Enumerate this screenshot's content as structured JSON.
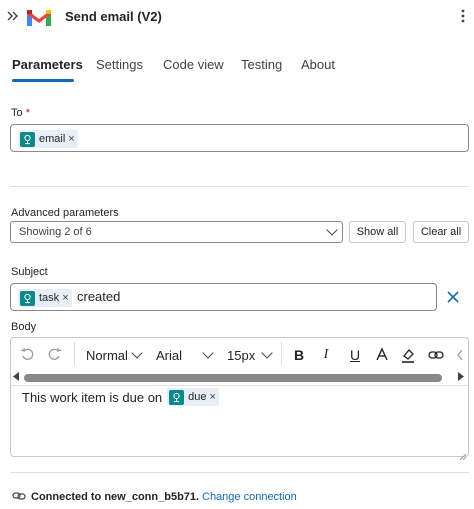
{
  "header": {
    "title": "Send email (V2)",
    "collapse_icon": "double-chevron-right-icon",
    "more_icon": "more-vertical-icon"
  },
  "tabs": [
    {
      "label": "Parameters",
      "active": true
    },
    {
      "label": "Settings",
      "active": false
    },
    {
      "label": "Code view",
      "active": false
    },
    {
      "label": "Testing",
      "active": false
    },
    {
      "label": "About",
      "active": false
    }
  ],
  "to": {
    "label": "To",
    "required_mark": "*",
    "token": "email",
    "token_remove": "×"
  },
  "advanced": {
    "label": "Advanced parameters",
    "dropdown_value": "Showing 2 of 6",
    "show_all": "Show all",
    "clear_all": "Clear all"
  },
  "subject": {
    "label": "Subject",
    "token": "task",
    "token_remove": "×",
    "text": "created",
    "clear_icon": "close-icon"
  },
  "body": {
    "label": "Body",
    "toolbar": {
      "undo_icon": "undo-icon",
      "redo_icon": "redo-icon",
      "format": "Normal",
      "font": "Arial",
      "size": "15px",
      "bold": "B",
      "italic": "I",
      "underline": "U",
      "font_color_icon": "font-color-icon",
      "highlight_icon": "highlight-icon",
      "link_icon": "link-icon",
      "code_icon": "code-icon"
    },
    "text": "This work item is due on",
    "token": "due",
    "token_remove": "×"
  },
  "footer": {
    "connection_text": "Connected to new_conn_b5b71.",
    "change_link": "Change connection"
  },
  "colors": {
    "accent": "#0f6cbd",
    "token_bg": "#e8eef6",
    "token_icon": "#0a8a8a"
  }
}
